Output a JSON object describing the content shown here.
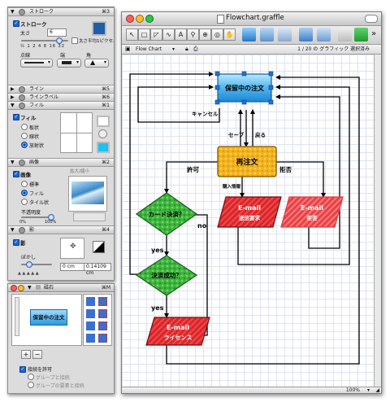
{
  "inspector": {
    "stroke": {
      "header": "ストローク",
      "shortcut": "⌘3",
      "checkbox_label": "ストローク",
      "width_label": "太さ",
      "width_value": "6",
      "hairline_label": "太さ平均1ピクセル",
      "ticks": [
        "½",
        "1",
        "2",
        "4",
        "8",
        "16",
        "32"
      ],
      "dash_label": "点線",
      "tip_label": "端",
      "corner_label": "角",
      "color": "#1f5ea8"
    },
    "lines": {
      "header": "ライン",
      "shortcut": "⌘5"
    },
    "line_label": {
      "header": "ラインラベル",
      "shortcut": "⌘6"
    },
    "fill": {
      "header": "フィル",
      "shortcut": "⌘1",
      "checkbox_label": "フィル",
      "options": [
        "板状",
        "線状",
        "放射状"
      ],
      "selected": "放射状",
      "color_top": "#ffffff",
      "color_bottom": "#19c3ef"
    },
    "image": {
      "header": "画像",
      "shortcut": "⌘2",
      "checkbox_label": "画像",
      "options": [
        "標準",
        "フィル",
        "タイル状"
      ],
      "selected": "フィル",
      "scale_label": "拡大/縮小",
      "opacity_label": "不透明度",
      "opacity_min": "0%",
      "opacity_max": "100%"
    },
    "shadow": {
      "header": "影",
      "shortcut": "⌘4",
      "checkbox_label": "影",
      "blur_label": "ぼかし",
      "x_value": "0 cm",
      "y_value": "0.14109 cm"
    }
  },
  "stencils": {
    "title": "磁石",
    "shortcut": "⌘M",
    "preview_label": "保留中の注文",
    "add_label": "+",
    "remove_label": "−",
    "allow_label": "接続を許可",
    "option1": "グループと接続",
    "option2": "グループの要素と接続"
  },
  "window": {
    "title": "Flowchart.graffle",
    "layer_label": "Flow Chart",
    "status_text": "1 / 20 の グラフィック 選択済み",
    "zoom": "100%"
  },
  "flow": {
    "pending": "保留中の注文",
    "new_order": "再注文",
    "card_check": "カード決済？",
    "payment_ok": "決済成功？",
    "email1_line1": "E-mail",
    "email1_line2": "送信要求",
    "email2_line1": "E-mail",
    "email2_line2": "拒否",
    "email3_line1": "E-mail",
    "email3_line2": "ライセンス",
    "cancel": "キャンセル",
    "save": "セーブ",
    "back": "戻る",
    "approve": "許可",
    "reject": "拒否",
    "purchase_info": "購入情報",
    "no": "no",
    "yes1": "yes",
    "yes2": "yes"
  },
  "colors": {
    "blue": "#3aa6e6",
    "orange": "#f2b21c",
    "green": "#39b53b",
    "red": "#d9262b",
    "selection": "#1e74d6"
  }
}
